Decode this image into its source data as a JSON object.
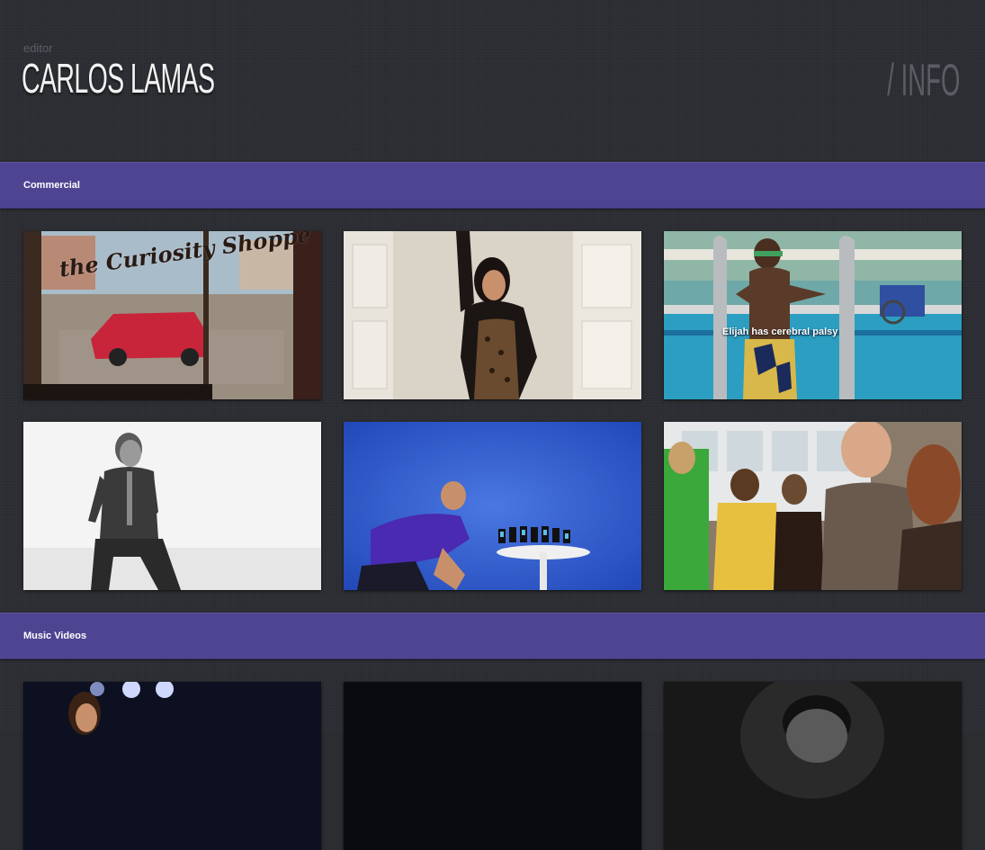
{
  "header": {
    "role": "editor",
    "name": "CARLOS LAMAS",
    "nav_slash": "/",
    "nav_info": "INFO"
  },
  "sections": [
    {
      "title": "Commercial",
      "items": [
        {
          "sign": "the Curiosity Shoppe",
          "caption": ""
        },
        {
          "caption": ""
        },
        {
          "caption": "Elijah has cerebral palsy"
        },
        {
          "caption": ""
        },
        {
          "caption": ""
        },
        {
          "caption": ""
        }
      ]
    },
    {
      "title": "Music Videos",
      "items": [
        {
          "caption": ""
        },
        {
          "caption": ""
        },
        {
          "caption": ""
        }
      ]
    }
  ],
  "colors": {
    "background": "#2c2e33",
    "section_bar": "#4e4592",
    "name_text": "#f2f2f2",
    "nav_text": "#5a5d63"
  }
}
